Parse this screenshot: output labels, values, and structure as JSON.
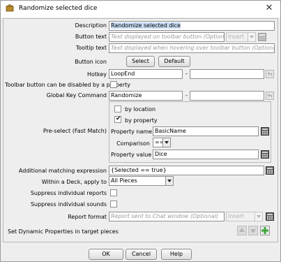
{
  "window": {
    "title": "Randomize selected dice",
    "close_glyph": "✕"
  },
  "form": {
    "description": {
      "label": "Description",
      "value": "Randomize selected dice"
    },
    "button_text": {
      "label": "Button text",
      "placeholder": "Text displayed on toolbar button (Optional)",
      "combo_value": "Insert"
    },
    "tooltip_text": {
      "label": "Tooltip text",
      "placeholder": "Text displayed when hovering over toolbar button (Optional)"
    },
    "button_icon": {
      "label": "Button icon",
      "select_label": "Select",
      "default_label": "Default"
    },
    "hotkey": {
      "label": "Hotkey",
      "value": "LoopEnd",
      "separator": "-"
    },
    "toolbar_disable": {
      "label": "Toolbar button can be disabled by a property",
      "checked": false
    },
    "global_key_command": {
      "label": "Global Key Command",
      "value": "Randomize",
      "separator": "-"
    },
    "preselect": {
      "label": "Pre-select (Fast Match)",
      "by_location": {
        "label": "by location",
        "checked": false
      },
      "by_property": {
        "label": "by property",
        "checked": true
      },
      "property_name": {
        "label": "Property name",
        "value": "BasicName"
      },
      "comparison": {
        "label": "Comparison",
        "value": "=="
      },
      "property_value": {
        "label": "Property value",
        "value": "Dice"
      }
    },
    "additional_matching": {
      "label": "Additional matching expression",
      "value": "{Selected == true}"
    },
    "within_deck": {
      "label": "Within a Deck, apply to",
      "value": "All Pieces"
    },
    "suppress_reports": {
      "label": "Suppress individual reports",
      "checked": false
    },
    "suppress_sounds": {
      "label": "Suppress individual sounds",
      "checked": false
    },
    "report_format": {
      "label": "Report format",
      "placeholder": "Report sent to Chat window (Optional)",
      "combo_value": "Insert"
    },
    "dynamic_properties": {
      "label": "Set Dynamic Properties in target pieces"
    }
  },
  "buttons": {
    "ok": "OK",
    "cancel": "Cancel",
    "help": "Help"
  },
  "colors": {
    "window_bg": "#eeeeee",
    "selection": "#c9dcf4",
    "add_green": "#3da63d"
  }
}
